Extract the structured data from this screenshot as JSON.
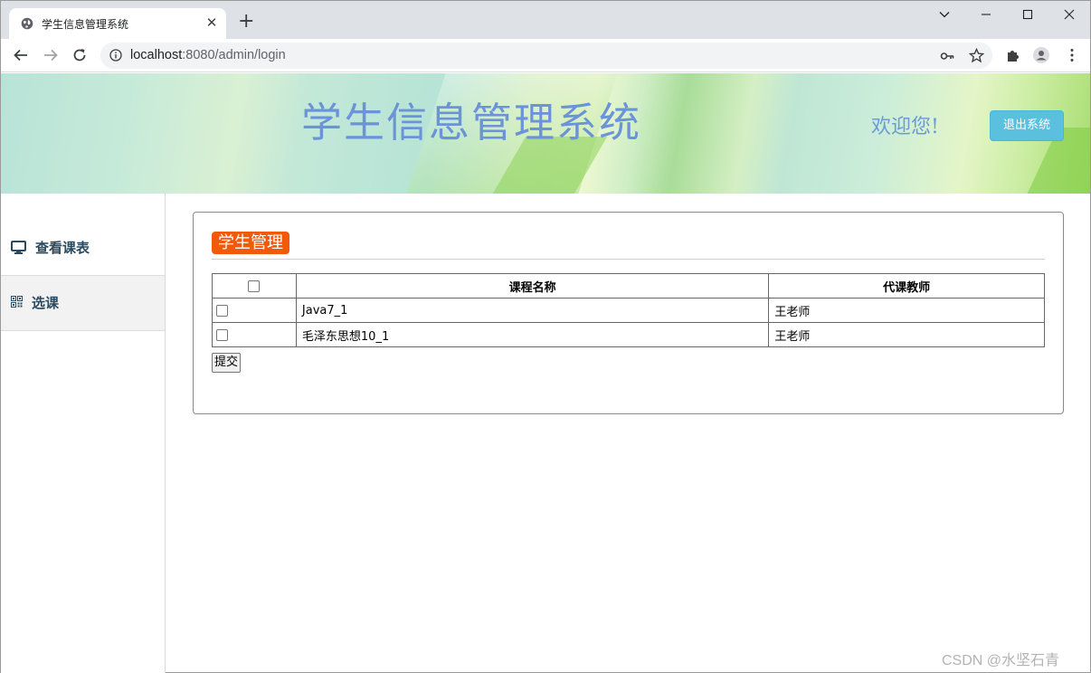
{
  "browser": {
    "tab_title": "学生信息管理系统",
    "url_host": "localhost",
    "url_rest": ":8080/admin/login"
  },
  "header": {
    "title": "学生信息管理系统",
    "welcome": "欢迎您!",
    "logout_label": "退出系统"
  },
  "sidebar": {
    "items": [
      {
        "label": "查看课表",
        "icon": "monitor-icon"
      },
      {
        "label": "选课",
        "icon": "qrcode-icon"
      }
    ]
  },
  "main": {
    "section_title": "学生管理",
    "table": {
      "columns": [
        "",
        "课程名称",
        "代课教师"
      ],
      "rows": [
        {
          "course": "Java7_1",
          "teacher": "王老师",
          "checked": false
        },
        {
          "course": "毛泽东思想10_1",
          "teacher": "王老师",
          "checked": false
        }
      ]
    },
    "submit_label": "提交"
  },
  "watermark": "CSDN @水坚石青",
  "colors": {
    "title": "#6a93d8",
    "logout_button": "#5bc0de",
    "section_badge": "#f25a0b"
  }
}
